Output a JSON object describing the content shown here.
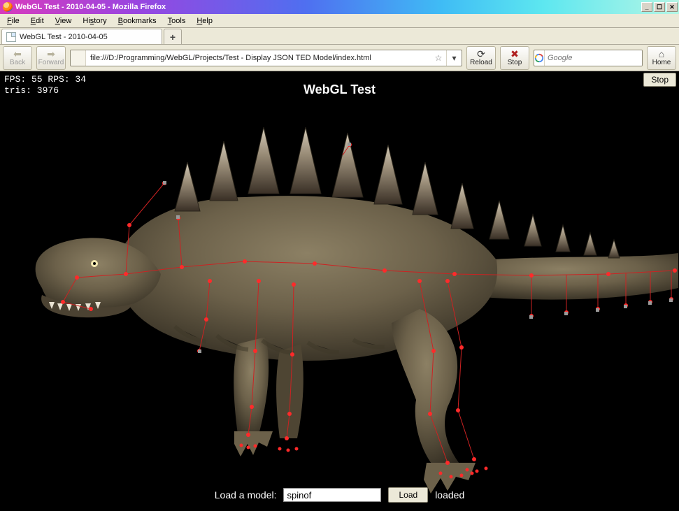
{
  "window": {
    "title": "WebGL Test - 2010-04-05 - Mozilla Firefox"
  },
  "menu": [
    "File",
    "Edit",
    "View",
    "History",
    "Bookmarks",
    "Tools",
    "Help"
  ],
  "tab": {
    "label": "WebGL Test - 2010-04-05"
  },
  "newtab_symbol": "+",
  "nav": {
    "back": "Back",
    "forward": "Forward"
  },
  "address": {
    "url": "file:///D:/Programming/WebGL/Projects/Test - Display JSON TED Model/index.html"
  },
  "toolbar": {
    "reload": "Reload",
    "stop": "Stop",
    "home": "Home"
  },
  "search": {
    "placeholder": "Google"
  },
  "page": {
    "title": "WebGL Test",
    "stop_label": "Stop",
    "stats_line1": "FPS: 55 RPS: 34",
    "stats_line2": "tris: 3976",
    "load_label": "Load a model:",
    "model_value": "spinof",
    "load_button": "Load",
    "load_status": "loaded"
  },
  "colors": {
    "canvas_bg": "#000000",
    "bone_line": "#cc2222",
    "joint": "#ff2a2a"
  }
}
